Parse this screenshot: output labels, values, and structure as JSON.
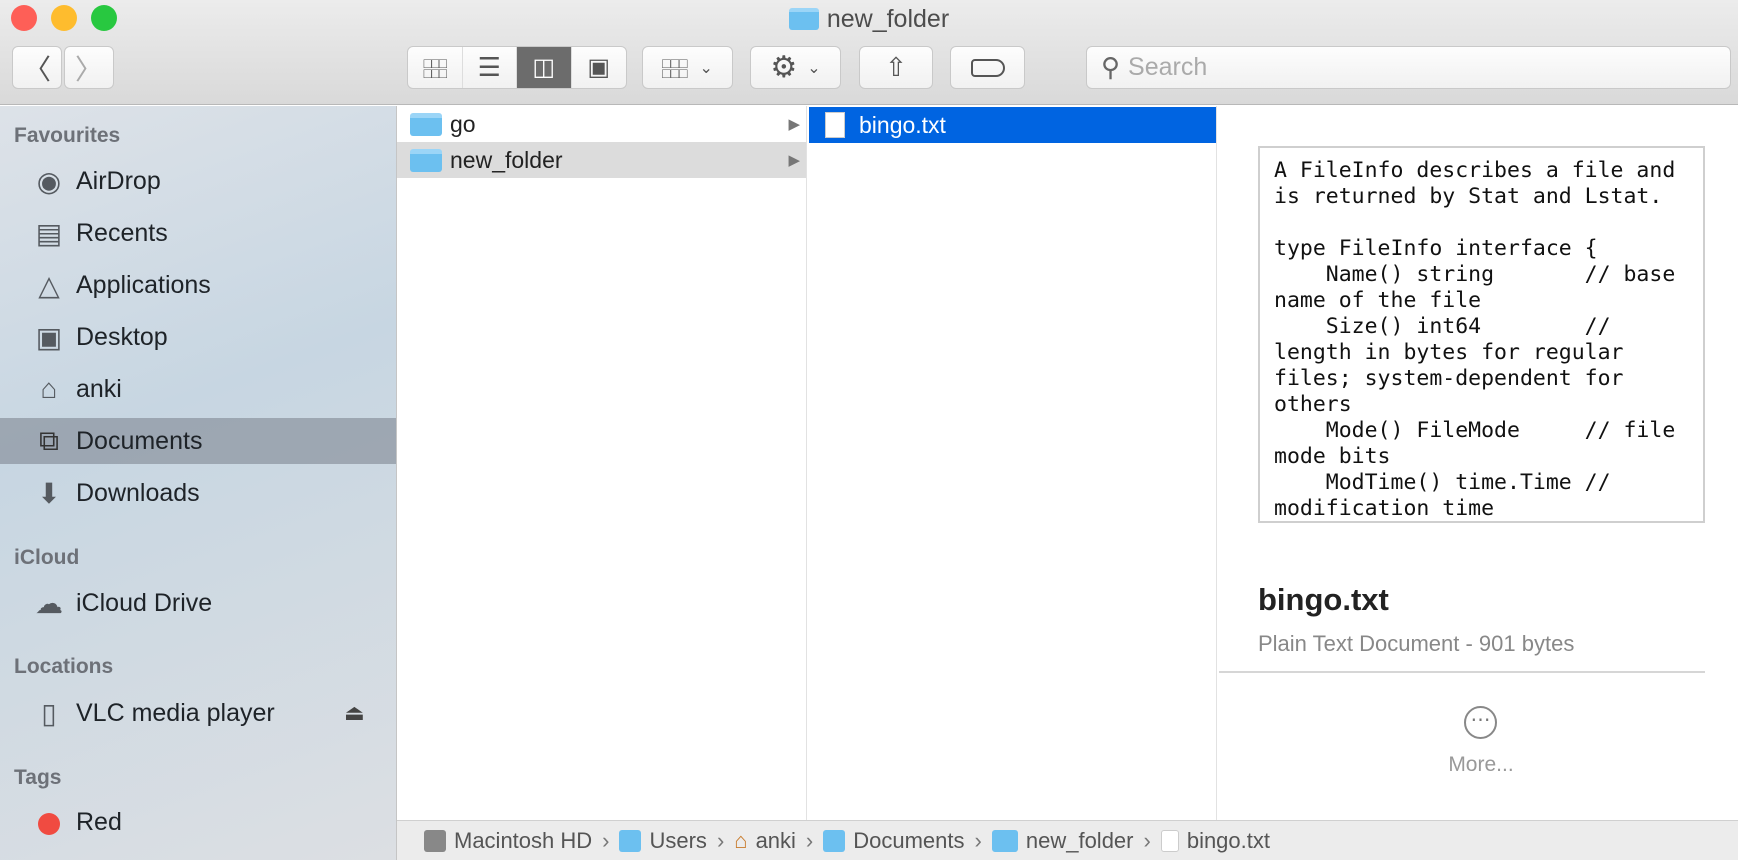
{
  "window": {
    "title": "new_folder",
    "traffic_lights": {
      "close": "#fe5f57",
      "minimize": "#febc2e",
      "zoom": "#28c840"
    }
  },
  "toolbar": {
    "back_icon": "chevron-left-icon",
    "forward_icon": "chevron-right-icon",
    "view_modes": [
      "icon-view",
      "list-view",
      "column-view",
      "gallery-view"
    ],
    "selected_view": "column-view",
    "search_placeholder": "Search"
  },
  "sidebar": {
    "sections": [
      {
        "header": "Favourites",
        "items": [
          {
            "label": "AirDrop",
            "icon": "airdrop-icon"
          },
          {
            "label": "Recents",
            "icon": "recents-icon"
          },
          {
            "label": "Applications",
            "icon": "applications-icon"
          },
          {
            "label": "Desktop",
            "icon": "desktop-icon"
          },
          {
            "label": "anki",
            "icon": "home-icon"
          },
          {
            "label": "Documents",
            "icon": "documents-icon",
            "selected": true
          },
          {
            "label": "Downloads",
            "icon": "downloads-icon"
          }
        ]
      },
      {
        "header": "iCloud",
        "items": [
          {
            "label": "iCloud Drive",
            "icon": "cloud-icon"
          }
        ]
      },
      {
        "header": "Locations",
        "items": [
          {
            "label": "VLC media player",
            "icon": "disk-icon",
            "eject": true
          }
        ]
      },
      {
        "header": "Tags",
        "items": [
          {
            "label": "Red",
            "color": "#f04b41"
          }
        ]
      }
    ]
  },
  "columns": [
    {
      "items": [
        {
          "name": "go",
          "type": "folder"
        },
        {
          "name": "new_folder",
          "type": "folder",
          "highlighted": true
        }
      ]
    },
    {
      "items": [
        {
          "name": "bingo.txt",
          "type": "file",
          "selected": true
        }
      ]
    }
  ],
  "preview": {
    "content": "A FileInfo describes a file and\nis returned by Stat and Lstat.\n\ntype FileInfo interface {\n    Name() string       // base\nname of the file\n    Size() int64        //\nlength in bytes for regular\nfiles; system-dependent for\nothers\n    Mode() FileMode     // file\nmode bits\n    ModTime() time.Time //\nmodification time\n    IsDir() bool        //",
    "filename": "bingo.txt",
    "kind": "Plain Text Document - 901 bytes",
    "more_label": "More..."
  },
  "pathbar": [
    "Macintosh HD",
    "Users",
    "anki",
    "Documents",
    "new_folder",
    "bingo.txt"
  ],
  "colors": {
    "selection": "#0064e1",
    "highlight": "#dcdcdc"
  }
}
